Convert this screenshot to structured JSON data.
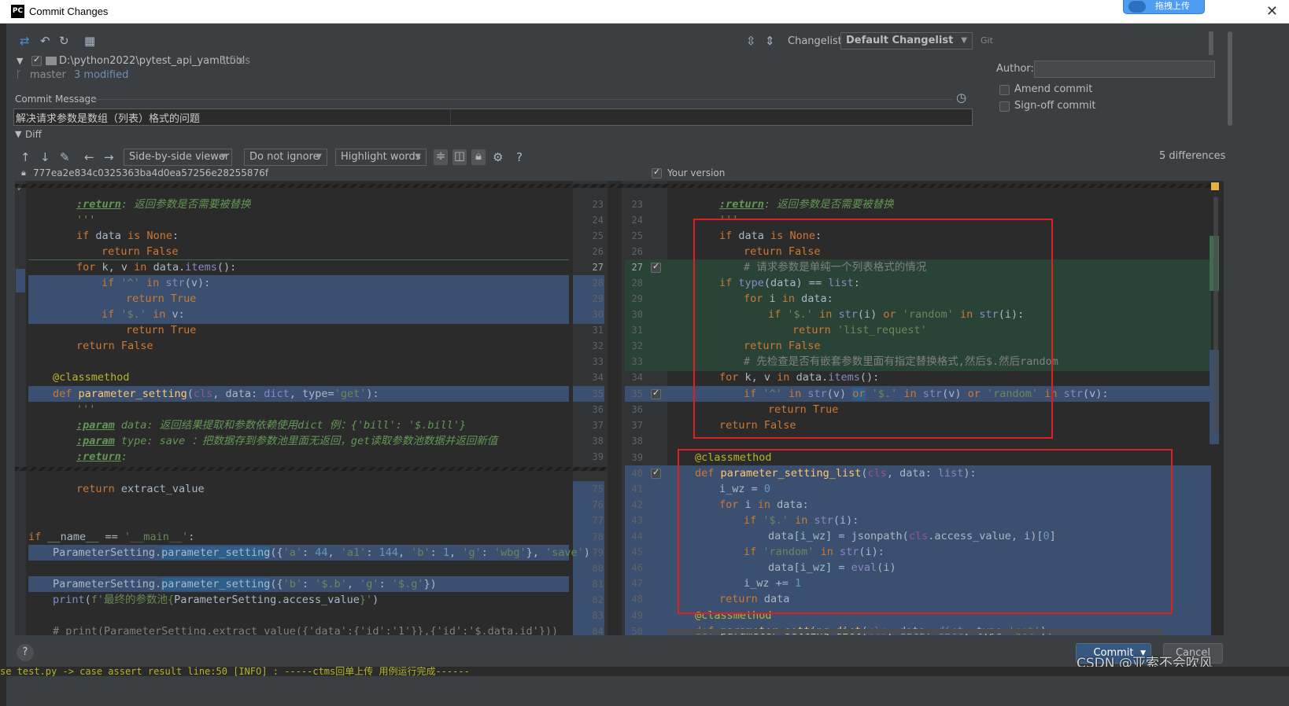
{
  "window": {
    "title": "Commit Changes",
    "upload_badge": "拖拽上传"
  },
  "toolbar": {
    "changelist_label": "Changelist:",
    "changelist_value": "Default Changelist",
    "git_label": "Git"
  },
  "tree": {
    "path": "D:\\python2022\\pytest_api_yaml\\tool",
    "file_count": "3 files",
    "branch": "master",
    "modified": "3 modified"
  },
  "commit": {
    "message_label": "Commit Message",
    "message_value": "解决请求参数是数组（列表）格式的问题"
  },
  "git_panel": {
    "author_label": "Author:",
    "author_value": "",
    "amend_label": "Amend commit",
    "signoff_label": "Sign-off commit"
  },
  "diff": {
    "section_label": "Diff",
    "viewer": "Side-by-side viewer",
    "ignore": "Do not ignore",
    "highlight": "Highlight words",
    "differences": "5 differences",
    "left_hash": "777ea2e834c0325363ba4d0ea57256e28255876f",
    "right_title": "Your version"
  },
  "left_numbers": [
    "23",
    "24",
    "25",
    "26",
    "27",
    "28",
    "29",
    "30",
    "31",
    "32",
    "33",
    "34",
    "35",
    "36",
    "37",
    "38",
    "39",
    "75",
    "76",
    "77",
    "78",
    "79",
    "80",
    "81",
    "82",
    "83",
    "84"
  ],
  "right_numbers": [
    "23",
    "24",
    "25",
    "26",
    "27",
    "28",
    "29",
    "30",
    "31",
    "32",
    "33",
    "34",
    "35",
    "36",
    "37",
    "38",
    "39",
    "40",
    "41",
    "42",
    "43",
    "44",
    "45",
    "46",
    "47",
    "48",
    "49",
    "50"
  ],
  "buttons": {
    "help": "?",
    "commit": "Commit",
    "cancel": "Cancel"
  },
  "watermark": "CSDN @亚索不会吹风",
  "console_line": "se test.py -> case_assert_result line:50 [INFO] : -----ctms回单上传 用例运行完成------"
}
